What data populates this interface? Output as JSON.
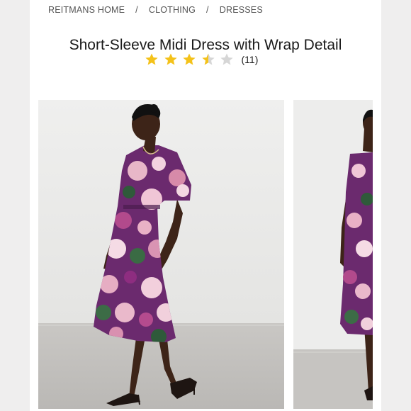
{
  "breadcrumb": {
    "items": [
      "REITMANS HOME",
      "CLOTHING",
      "DRESSES"
    ],
    "separator": "/"
  },
  "product": {
    "title": "Short-Sleeve Midi Dress with Wrap Detail",
    "rating": 3.5,
    "rating_max": 5,
    "review_count": "(11)"
  },
  "colors": {
    "star_filled": "#f4c21a",
    "star_empty": "#d6d6d6",
    "dress_primary": "#6b2a6e",
    "backdrop": "#ececea"
  }
}
